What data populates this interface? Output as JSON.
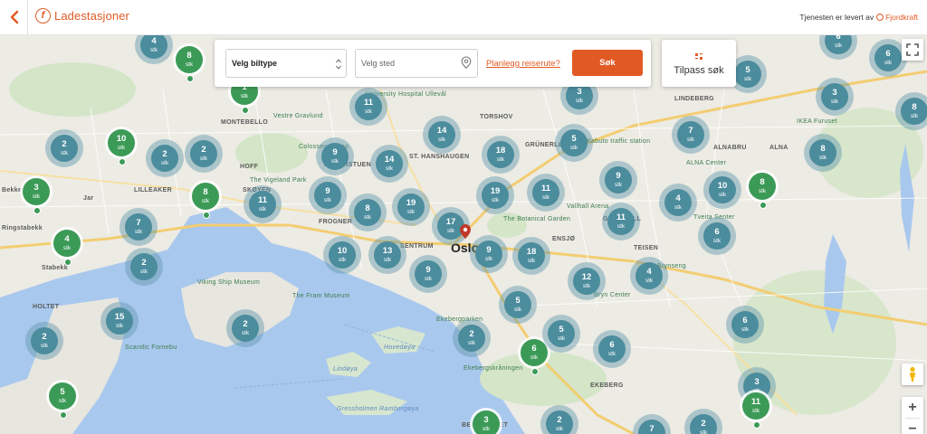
{
  "header": {
    "title": "Ladestasjoner",
    "logo_letter": "f",
    "provider_text": "Tjenesten er levert av",
    "provider_name": "Fjordkraft"
  },
  "search": {
    "vehicle_select_value": "Velg biltype",
    "place_placeholder": "Velg sted",
    "route_link": "Planlegg reiserute?",
    "search_button": "Søk",
    "filter_label": "Tilpass søk"
  },
  "colors": {
    "accent": "#e15a24",
    "cluster_blue": "#4b8c9d",
    "cluster_green": "#3c9a57"
  },
  "map": {
    "unit": "stk",
    "places": [
      {
        "name": "MONTEBELLO",
        "type": "district"
      },
      {
        "name": "HOFF",
        "type": "district"
      },
      {
        "name": "LILLEAKER",
        "type": "district"
      },
      {
        "name": "SKØYEN",
        "type": "district"
      },
      {
        "name": "FROGNER",
        "type": "district"
      },
      {
        "name": "MAJORSTUEN",
        "type": "district"
      },
      {
        "name": "ST. HANSHAUGEN",
        "type": "district"
      },
      {
        "name": "GRÜNERLØKKA",
        "type": "district"
      },
      {
        "name": "TORSHOV",
        "type": "district"
      },
      {
        "name": "SENTRUM",
        "type": "district"
      },
      {
        "name": "ENSJØ",
        "type": "district"
      },
      {
        "name": "TEISEN",
        "type": "district"
      },
      {
        "name": "GRØNVOLL",
        "type": "district"
      },
      {
        "name": "ALNABRU",
        "type": "district"
      },
      {
        "name": "ALNA",
        "type": "district"
      },
      {
        "name": "LINDEBERG",
        "type": "district"
      },
      {
        "name": "Jar",
        "type": "district"
      },
      {
        "name": "Stabekk",
        "type": "district"
      },
      {
        "name": "HOLTET",
        "type": "district"
      },
      {
        "name": "EKEBERG",
        "type": "district"
      },
      {
        "name": "BEKKELAGET",
        "type": "district"
      },
      {
        "name": "Ringstabekk",
        "type": "district"
      },
      {
        "name": "Bekkestua",
        "type": "district"
      },
      {
        "name": "Oslo",
        "type": "city"
      },
      {
        "name": "Hovedøya",
        "type": "water"
      },
      {
        "name": "Lindøya",
        "type": "water"
      },
      {
        "name": "Gressholmen Rambergøya",
        "type": "water"
      },
      {
        "name": "Ekebergskråningen",
        "type": "poi"
      },
      {
        "name": "The Vigeland Park",
        "type": "poi"
      },
      {
        "name": "Colosseum Kino",
        "type": "poi"
      },
      {
        "name": "Viking Ship Museum",
        "type": "poi"
      },
      {
        "name": "The Fram Museum",
        "type": "poi"
      },
      {
        "name": "The Botanical Garden",
        "type": "poi"
      },
      {
        "name": "Vestre Gravlund",
        "type": "poi"
      },
      {
        "name": "University Hospital Ullevål",
        "type": "poi"
      },
      {
        "name": "Vallhall Arena",
        "type": "poi"
      },
      {
        "name": "Tveita Senter",
        "type": "poi"
      },
      {
        "name": "ALNA Center",
        "type": "poi"
      },
      {
        "name": "Brynseng",
        "type": "poi"
      },
      {
        "name": "Scandic Fornebu",
        "type": "poi"
      },
      {
        "name": "Ekebergparken",
        "type": "poi"
      },
      {
        "name": "IKEA Furuset",
        "type": "poi"
      },
      {
        "name": "Bryn Center",
        "type": "poi"
      },
      {
        "name": "Kabuto traffic station",
        "type": "poi"
      }
    ],
    "clusters": [
      {
        "count": "4",
        "color": "blue"
      },
      {
        "count": "8",
        "color": "green"
      },
      {
        "count": "1",
        "color": "green"
      },
      {
        "count": "11",
        "color": "blue"
      },
      {
        "count": "3",
        "color": "blue"
      },
      {
        "count": "6",
        "color": "blue"
      },
      {
        "count": "6",
        "color": "blue"
      },
      {
        "count": "5",
        "color": "blue"
      },
      {
        "count": "3",
        "color": "blue"
      },
      {
        "count": "8",
        "color": "blue"
      },
      {
        "count": "2",
        "color": "blue"
      },
      {
        "count": "10",
        "color": "green"
      },
      {
        "count": "2",
        "color": "blue"
      },
      {
        "count": "2",
        "color": "blue"
      },
      {
        "count": "9",
        "color": "blue"
      },
      {
        "count": "14",
        "color": "blue"
      },
      {
        "count": "14",
        "color": "blue"
      },
      {
        "count": "18",
        "color": "blue"
      },
      {
        "count": "5",
        "color": "blue"
      },
      {
        "count": "7",
        "color": "blue"
      },
      {
        "count": "8",
        "color": "blue"
      },
      {
        "count": "3",
        "color": "green"
      },
      {
        "count": "8",
        "color": "green"
      },
      {
        "count": "11",
        "color": "blue"
      },
      {
        "count": "9",
        "color": "blue"
      },
      {
        "count": "8",
        "color": "blue"
      },
      {
        "count": "19",
        "color": "blue"
      },
      {
        "count": "17",
        "color": "blue"
      },
      {
        "count": "19",
        "color": "blue"
      },
      {
        "count": "11",
        "color": "blue"
      },
      {
        "count": "9",
        "color": "blue"
      },
      {
        "count": "4",
        "color": "blue"
      },
      {
        "count": "10",
        "color": "blue"
      },
      {
        "count": "8",
        "color": "green"
      },
      {
        "count": "7",
        "color": "blue"
      },
      {
        "count": "11",
        "color": "blue"
      },
      {
        "count": "4",
        "color": "green"
      },
      {
        "count": "10",
        "color": "blue"
      },
      {
        "count": "13",
        "color": "blue"
      },
      {
        "count": "9",
        "color": "blue"
      },
      {
        "count": "18",
        "color": "blue"
      },
      {
        "count": "6",
        "color": "blue"
      },
      {
        "count": "2",
        "color": "blue"
      },
      {
        "count": "9",
        "color": "blue"
      },
      {
        "count": "5",
        "color": "blue"
      },
      {
        "count": "12",
        "color": "blue"
      },
      {
        "count": "4",
        "color": "blue"
      },
      {
        "count": "15",
        "color": "blue"
      },
      {
        "count": "2",
        "color": "blue"
      },
      {
        "count": "2",
        "color": "blue"
      },
      {
        "count": "2",
        "color": "blue"
      },
      {
        "count": "6",
        "color": "green"
      },
      {
        "count": "5",
        "color": "blue"
      },
      {
        "count": "6",
        "color": "blue"
      },
      {
        "count": "6",
        "color": "blue"
      },
      {
        "count": "5",
        "color": "green"
      },
      {
        "count": "3",
        "color": "green"
      },
      {
        "count": "2",
        "color": "blue"
      },
      {
        "count": "7",
        "color": "blue"
      },
      {
        "count": "2",
        "color": "blue"
      },
      {
        "count": "3",
        "color": "blue"
      },
      {
        "count": "11",
        "color": "green"
      }
    ]
  }
}
